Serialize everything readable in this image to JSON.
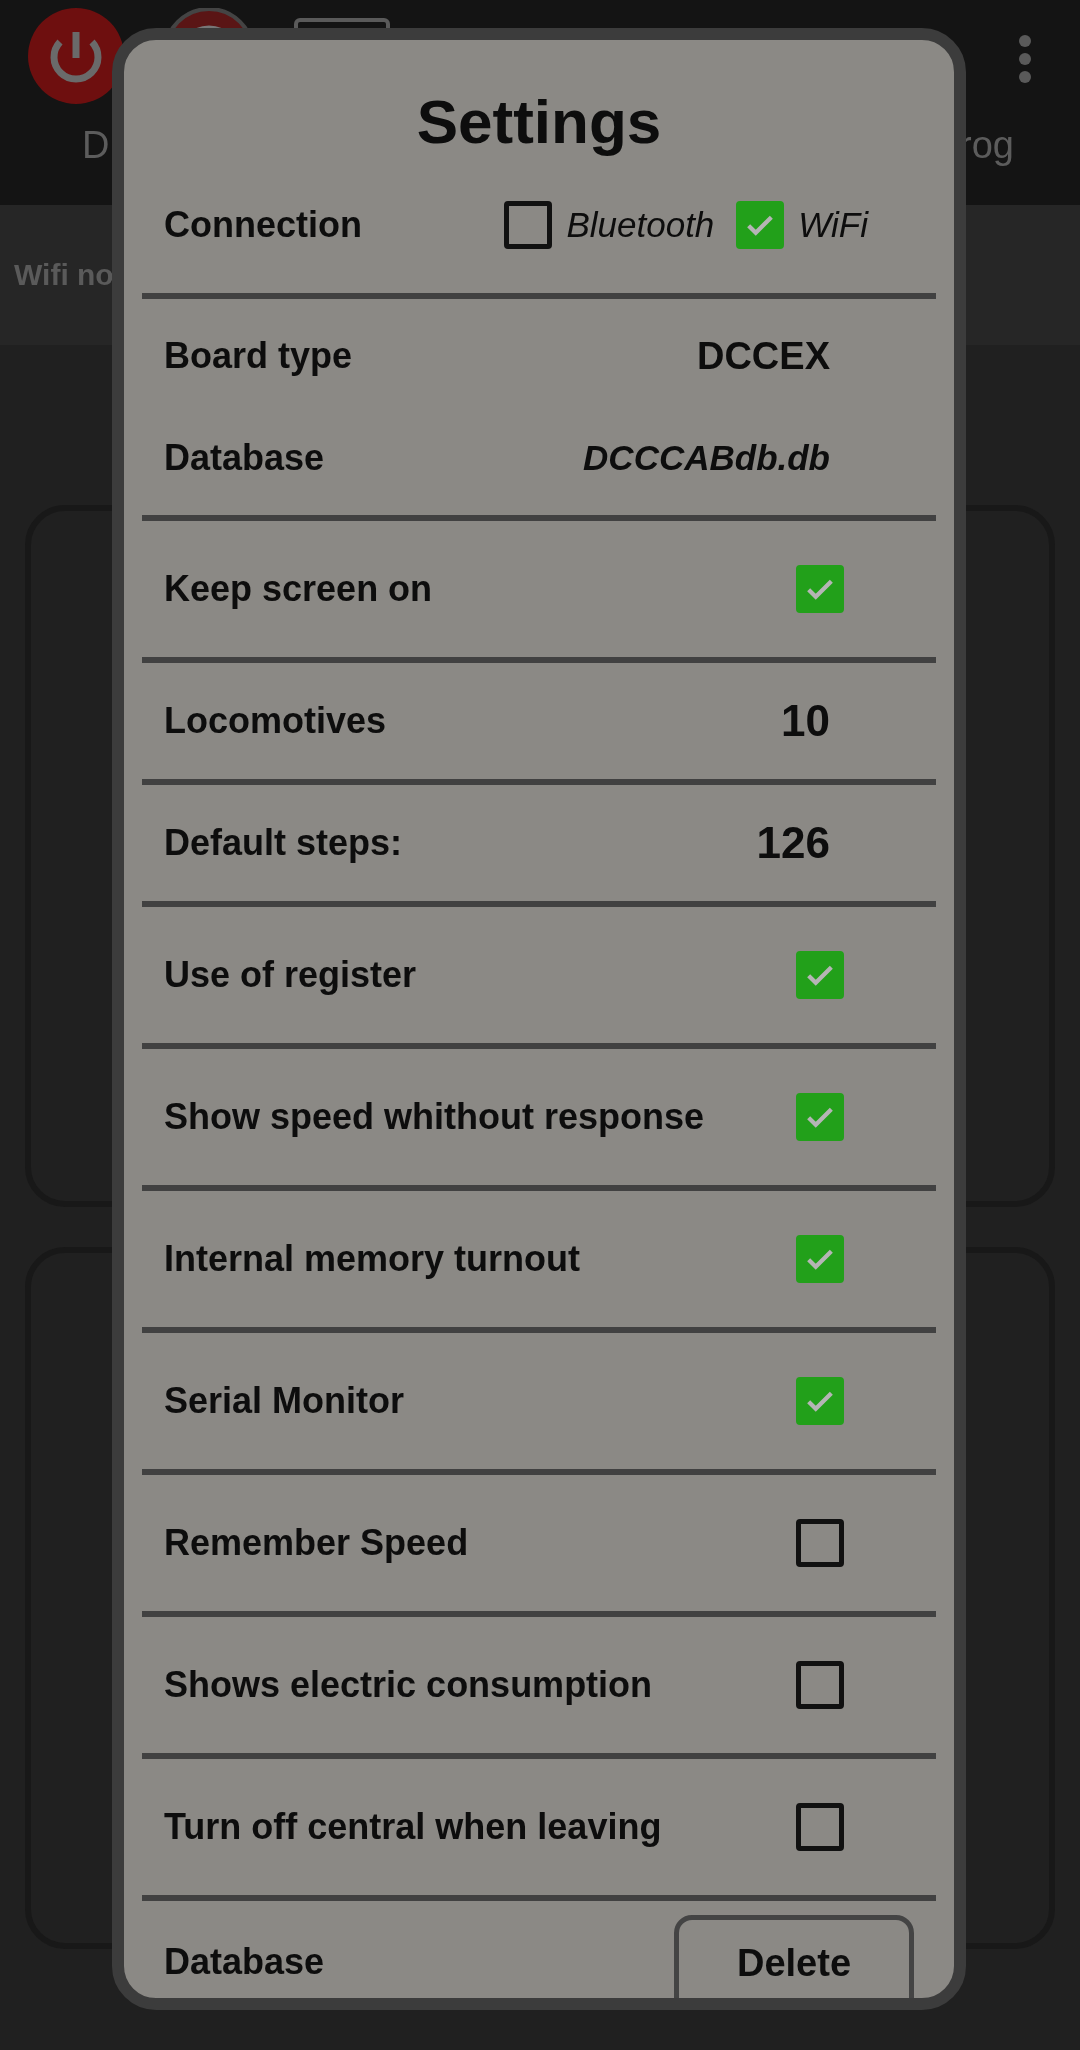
{
  "app_bar": {
    "tabs": [
      {
        "label": "D"
      },
      {
        "label": "rog"
      }
    ]
  },
  "status": "Wifi no",
  "dialog": {
    "title": "Settings",
    "connection": {
      "label": "Connection",
      "options": [
        {
          "label": "Bluetooth",
          "checked": false
        },
        {
          "label": "WiFi",
          "checked": true
        }
      ]
    },
    "sections": [
      {
        "rows": [
          {
            "kind": "value",
            "label": "Board type",
            "value": "DCCEX"
          },
          {
            "kind": "file",
            "label": "Database",
            "value": "DCCCABdb.db"
          }
        ]
      },
      {
        "rows": [
          {
            "kind": "checkbox",
            "label": "Keep screen on",
            "checked": true
          }
        ]
      },
      {
        "rows": [
          {
            "kind": "number",
            "label": "Locomotives",
            "value": "10"
          }
        ]
      },
      {
        "rows": [
          {
            "kind": "number",
            "label": "Default steps:",
            "value": "126"
          }
        ]
      },
      {
        "rows": [
          {
            "kind": "checkbox",
            "label": "Use of register",
            "checked": true
          }
        ]
      },
      {
        "rows": [
          {
            "kind": "checkbox",
            "label": "Show speed whithout response",
            "checked": true
          }
        ]
      },
      {
        "rows": [
          {
            "kind": "checkbox",
            "label": "Internal memory turnout",
            "checked": true
          }
        ]
      },
      {
        "rows": [
          {
            "kind": "checkbox",
            "label": "Serial Monitor",
            "checked": true
          }
        ]
      },
      {
        "rows": [
          {
            "kind": "checkbox",
            "label": "Remember Speed",
            "checked": false
          }
        ]
      },
      {
        "rows": [
          {
            "kind": "checkbox",
            "label": "Shows electric consumption",
            "checked": false
          }
        ]
      },
      {
        "rows": [
          {
            "kind": "checkbox",
            "label": "Turn off central when leaving",
            "checked": false
          }
        ]
      },
      {
        "rows": [
          {
            "kind": "button",
            "label": "Database",
            "button": "Delete"
          }
        ]
      }
    ]
  }
}
